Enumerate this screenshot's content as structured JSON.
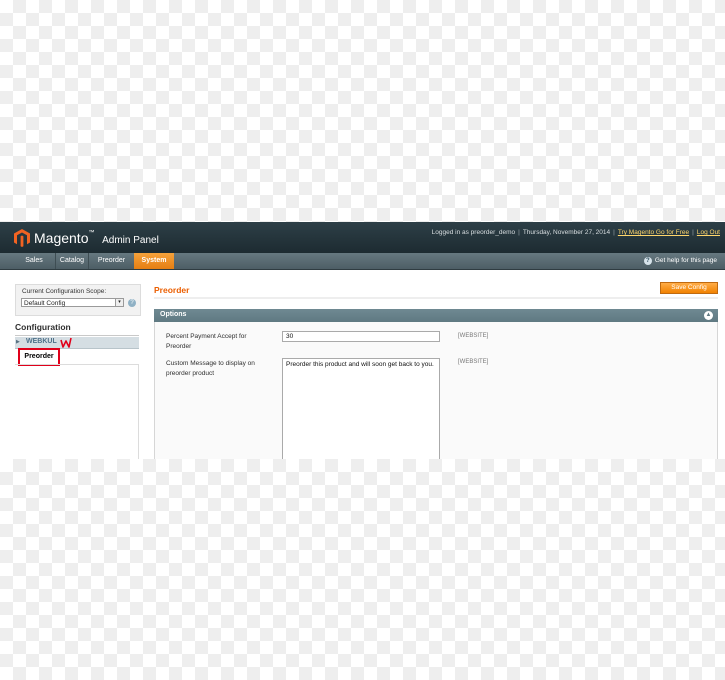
{
  "header": {
    "brand": "Magento",
    "trademark": "™",
    "subtitle": "Admin Panel",
    "logged_in": "Logged in as preorder_demo",
    "date": "Thursday, November 27, 2014",
    "link_try": "Try Magento Go for Free",
    "link_logout": "Log Out",
    "separator": "|"
  },
  "nav": {
    "items": [
      {
        "label": "Sales"
      },
      {
        "label": "Catalog"
      },
      {
        "label": "Preorder"
      },
      {
        "label": "System",
        "active": true
      }
    ],
    "help": "Get help for this page",
    "help_icon": "?"
  },
  "sidebar": {
    "scope_label": "Current Configuration Scope:",
    "scope_value": "Default Config",
    "scope_arrow": "▾",
    "scope_help_icon": "?",
    "configuration_title": "Configuration",
    "group_label": "WEBKUL",
    "group_arrow": "▶",
    "item_label": "Preorder"
  },
  "main": {
    "title": "Preorder",
    "save_button": "Save Config",
    "fieldset_title": "Options",
    "collapse_icon": "▲",
    "fields": [
      {
        "label": "Percent Payment Accept for Preorder",
        "value": "30",
        "scope": "[WEBSITE]"
      },
      {
        "label": "Custom Message to display on preorder product",
        "value": "Preorder this product and will soon get back to you.",
        "scope": "[WEBSITE]"
      }
    ]
  },
  "colors": {
    "accent_orange": "#eb5e00",
    "header_dark": "#1d2b31",
    "highlight_red": "#e0001a"
  }
}
